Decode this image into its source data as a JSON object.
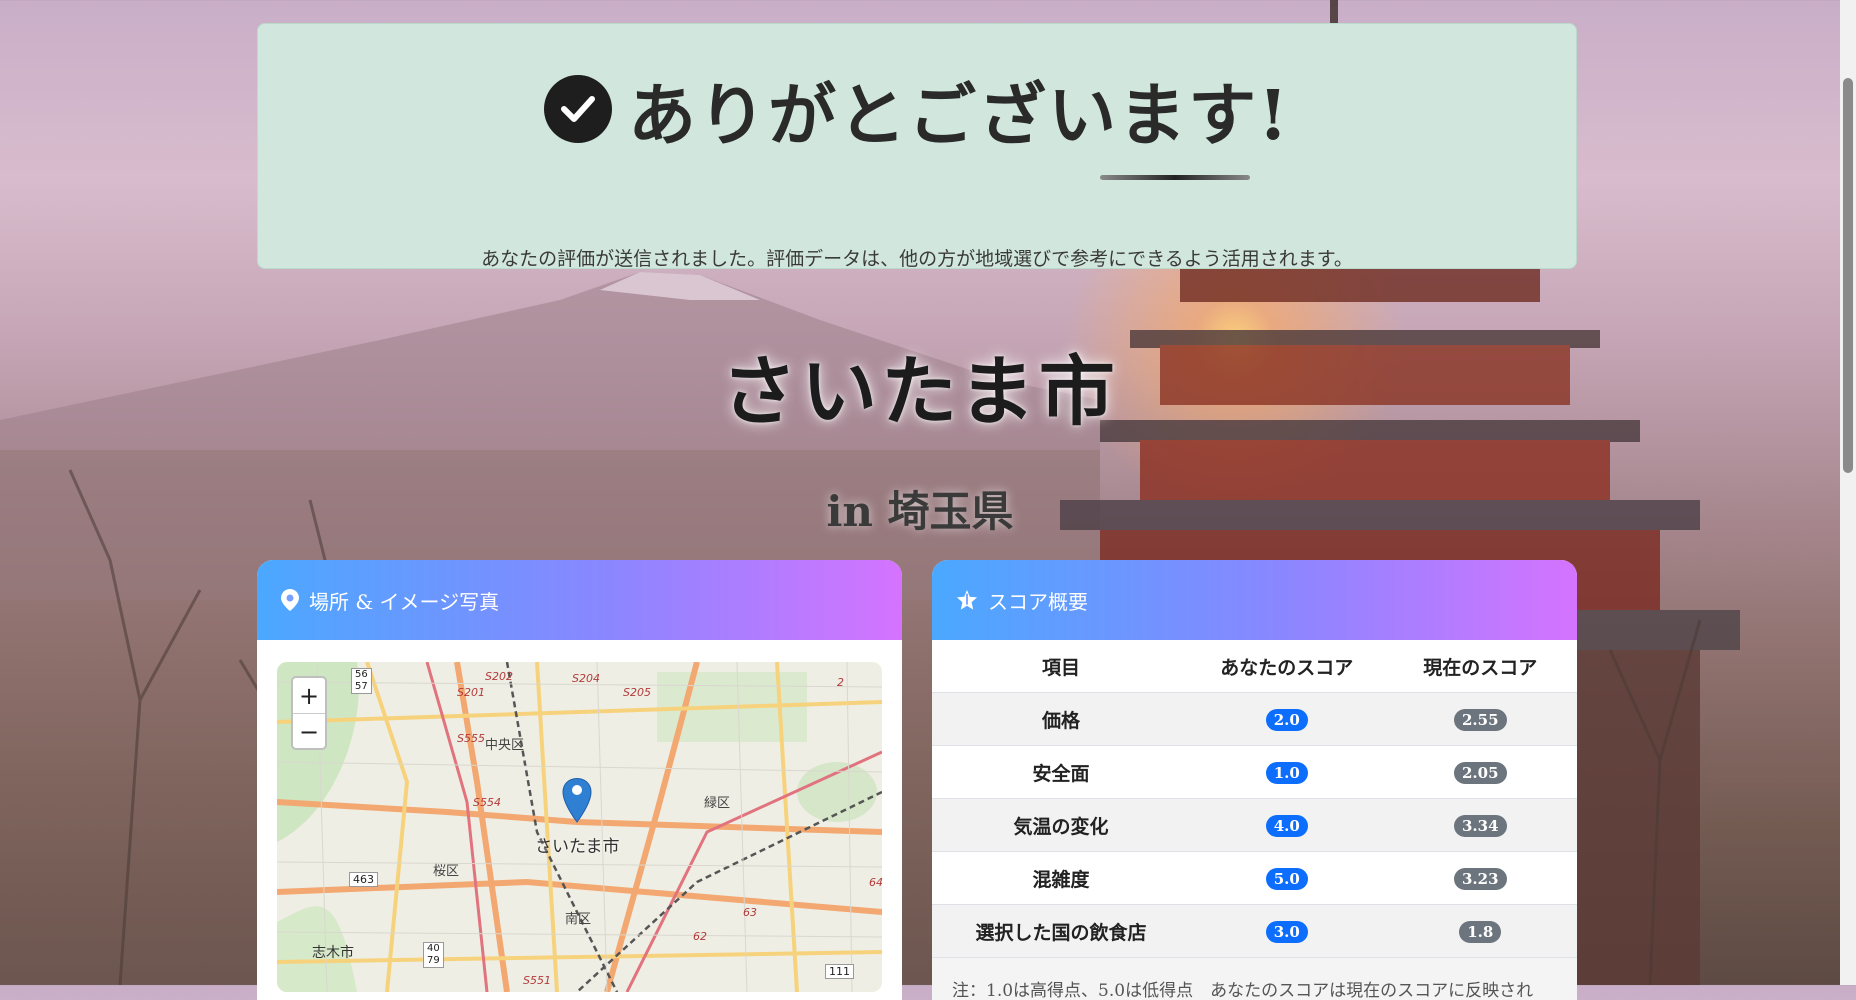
{
  "thanks": {
    "title": "ありがとございます!",
    "message": "あなたの評価が送信されました。評価データは、他の方が地域選びで参考にできるよう活用されます。"
  },
  "city": {
    "name": "さいたま市",
    "prefecture": "in 埼玉県"
  },
  "location_card": {
    "header": "場所 & イメージ写真",
    "zoom_in": "+",
    "zoom_out": "−",
    "map_labels": {
      "city": "さいたま市",
      "chuo": "中央区",
      "midori": "緑区",
      "sakura": "桜区",
      "minami": "南区",
      "shiki": "志木市",
      "r463": "463",
      "r4079": "40\n79",
      "r5657": "56\n57",
      "r111": "111",
      "s201": "S201",
      "s202": "S202",
      "s204": "S204",
      "s205": "S205",
      "s555": "S555",
      "s554": "S554",
      "s551": "S551",
      "n63": "63",
      "n62": "62",
      "n64": "64",
      "n2": "2"
    }
  },
  "score_card": {
    "header": "スコア概要",
    "columns": [
      "項目",
      "あなたのスコア",
      "現在のスコア"
    ],
    "rows": [
      {
        "item": "価格",
        "yours": "2.0",
        "current": "2.55"
      },
      {
        "item": "安全面",
        "yours": "1.0",
        "current": "2.05"
      },
      {
        "item": "気温の変化",
        "yours": "4.0",
        "current": "3.34"
      },
      {
        "item": "混雑度",
        "yours": "5.0",
        "current": "3.23"
      },
      {
        "item": "選択した国の飲食店",
        "yours": "3.0",
        "current": "1.8"
      }
    ],
    "note": "注：1.0は高得点、5.0は低得点　あなたのスコアは現在のスコアに反映され"
  },
  "colors": {
    "success_bg": "#d1e7dd",
    "header_gradient_start": "#4aa8ff",
    "header_gradient_end": "#d573ff",
    "your_score": "#0d6efd",
    "current_score": "#6c757d"
  }
}
